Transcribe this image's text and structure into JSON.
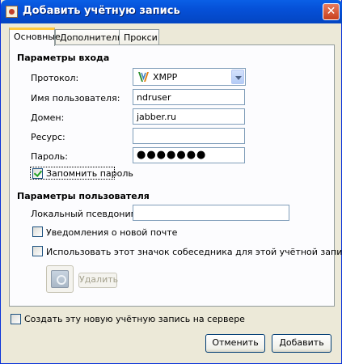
{
  "window": {
    "title": "Добавить учётную запись",
    "app_icon": "app-icon",
    "close_label": "✕"
  },
  "tabs": [
    {
      "label": "Основные",
      "active": true
    },
    {
      "label": "Дополнительно",
      "active": false
    },
    {
      "label": "Прокси",
      "active": false
    }
  ],
  "login": {
    "section_title": "Параметры входа",
    "protocol_label": "Протокол:",
    "protocol_value": "XMPP",
    "username_label": "Имя пользователя:",
    "username_value": "ndruser",
    "domain_label": "Домен:",
    "domain_value": "jabber.ru",
    "resource_label": "Ресурс:",
    "resource_value": "",
    "password_label": "Пароль:",
    "password_value": "●●●●●●●",
    "remember_label": "Запомнить пароль",
    "remember_checked": true
  },
  "user": {
    "section_title": "Параметры пользователя",
    "alias_label": "Локальный псевдоним:",
    "alias_value": "",
    "mail_notify_label": "Уведомления о новой почте",
    "mail_notify_checked": false,
    "buddy_icon_label": "Использовать этот значок собеседника для этой учётной записи:",
    "buddy_icon_checked": false,
    "remove_label": "Удалить"
  },
  "footer": {
    "create_on_server_label": "Создать эту новую учётную запись на сервере",
    "create_on_server_checked": false,
    "cancel_label": "Отменить",
    "add_label": "Добавить"
  },
  "colors": {
    "titlebar": "#0a5fe6",
    "tab_highlight": "#ffc83c",
    "dialog_bg": "#ece9d8",
    "panel_bg": "#fcfcfe"
  }
}
